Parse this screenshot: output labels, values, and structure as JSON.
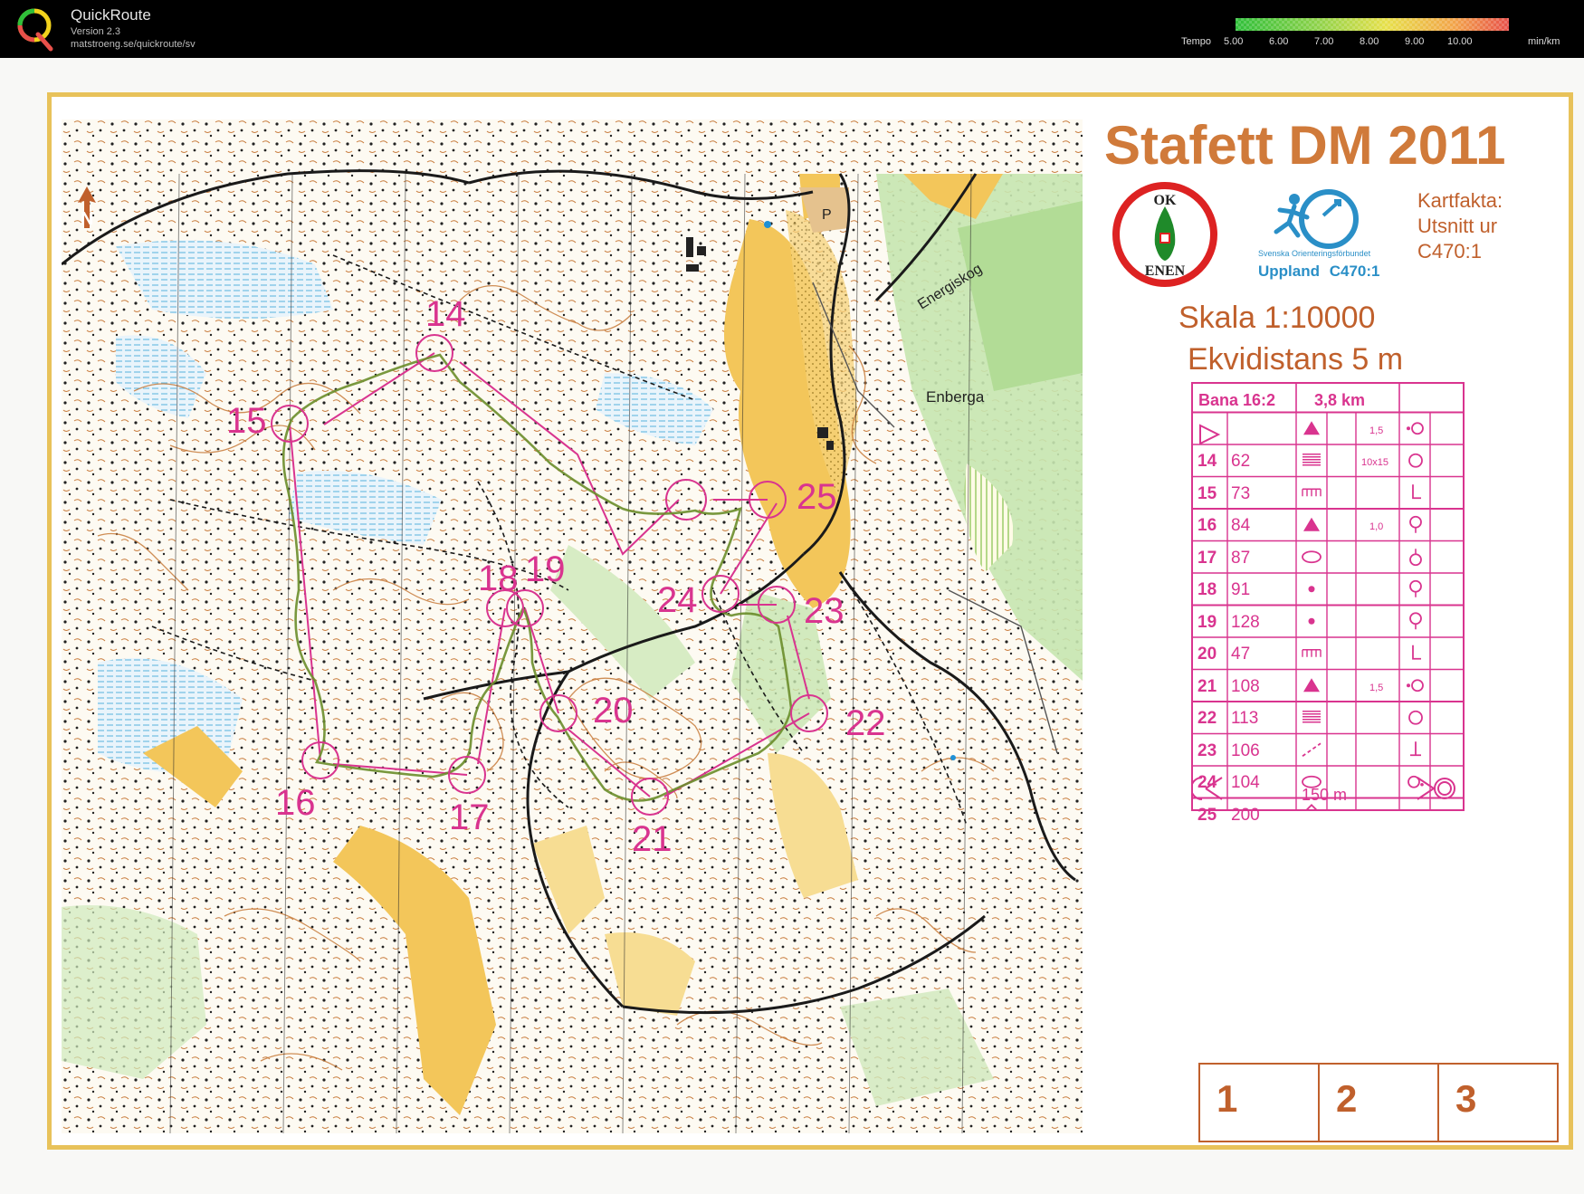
{
  "app": {
    "name": "QuickRoute",
    "version": "Version 2.3",
    "url": "matstroeng.se/quickroute/sv"
  },
  "tempo": {
    "label": "Tempo",
    "ticks": [
      "5.00",
      "6.00",
      "7.00",
      "8.00",
      "9.00",
      "10.00"
    ],
    "unit": "min/km",
    "gradient": [
      "#2fbf3a",
      "#8ed24a",
      "#e7e04a",
      "#f2a44a",
      "#e8504a"
    ]
  },
  "colors": {
    "course": "#d9348f",
    "route": "#6a8d2a",
    "legend_text": "#c0602c",
    "frame": "#e8c25a",
    "contour": "#c77a3a",
    "sof_blue": "#2a8fc7"
  },
  "map": {
    "title": "Stafett DM 2011",
    "club_logo": {
      "top": "OK",
      "bottom": "ENEN"
    },
    "federation": "Svenska Orienteringsförbundet",
    "region": "Uppland",
    "license": "C470:1",
    "kartfakta": [
      "Kartfakta:",
      "Utsnitt ur",
      "C470:1"
    ],
    "scale": "Skala  1:10000",
    "equidistance": "Ekvidistans  5 m",
    "place_labels": [
      "Energiskog",
      "Enberga",
      "P"
    ],
    "north_icon": "north-arrow-icon",
    "controls": [
      {
        "label": "14"
      },
      {
        "label": "15"
      },
      {
        "label": "16"
      },
      {
        "label": "17"
      },
      {
        "label": "18"
      },
      {
        "label": "19"
      },
      {
        "label": "20"
      },
      {
        "label": "21"
      },
      {
        "label": "22"
      },
      {
        "label": "23"
      },
      {
        "label": "24"
      },
      {
        "label": "25"
      }
    ]
  },
  "description_sheet": {
    "course": "Bana 16:2",
    "length": "3,8 km",
    "rows": [
      {
        "num": "",
        "code": "",
        "feature": "triangle-up-icon",
        "dim": "1,5",
        "loc": "dot-left-circle-icon"
      },
      {
        "num": "14",
        "code": "62",
        "feature": "stripes-icon",
        "dim": "10x15",
        "loc": "circle-icon"
      },
      {
        "num": "15",
        "code": "73",
        "feature": "comb-icon",
        "dim": "",
        "loc": "foot-icon"
      },
      {
        "num": "16",
        "code": "84",
        "feature": "triangle-up-icon",
        "dim": "1,0",
        "loc": "circle-bottom-icon"
      },
      {
        "num": "17",
        "code": "87",
        "feature": "ellipse-icon",
        "dim": "",
        "loc": "circle-top-icon"
      },
      {
        "num": "18",
        "code": "91",
        "feature": "dot-icon",
        "dim": "",
        "loc": "circle-bottom-icon"
      },
      {
        "num": "19",
        "code": "128",
        "feature": "dot-icon",
        "dim": "",
        "loc": "circle-bottom-icon"
      },
      {
        "num": "20",
        "code": "47",
        "feature": "comb-icon",
        "dim": "",
        "loc": "foot-icon"
      },
      {
        "num": "21",
        "code": "108",
        "feature": "triangle-up-icon",
        "dim": "1,5",
        "loc": "dot-left-circle-icon"
      },
      {
        "num": "22",
        "code": "113",
        "feature": "stripes-icon",
        "dim": "",
        "loc": "circle-icon"
      },
      {
        "num": "23",
        "code": "106",
        "feature": "diagonal-dash-icon",
        "dim": "",
        "loc": "t-bar-icon"
      },
      {
        "num": "24",
        "code": "104",
        "feature": "ellipse-icon",
        "dim": "",
        "loc": "circle-right-icon"
      },
      {
        "num": "25",
        "code": "200",
        "feature": "diamond-icon",
        "dim": "",
        "loc": "corner-icon"
      }
    ],
    "finish_distance": "150 m"
  },
  "relay_boxes": [
    "1",
    "2",
    "3"
  ]
}
